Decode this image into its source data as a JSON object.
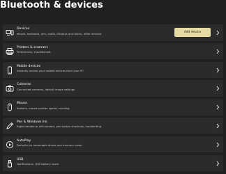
{
  "page": {
    "title": "Bluetooth & devices"
  },
  "items": [
    {
      "title": "Devices",
      "subtitle": "Mouse, keyboard, pen, audio, displays and docks, other devices",
      "action_label": "Add device",
      "icon": "devices-icon"
    },
    {
      "title": "Printers & scanners",
      "subtitle": "Preferences, troubleshoot",
      "icon": "printer-icon"
    },
    {
      "title": "Mobile devices",
      "subtitle": "Instantly access your mobile devices from your PC",
      "icon": "phone-icon"
    },
    {
      "title": "Cameras",
      "subtitle": "Connected cameras, default image settings",
      "icon": "camera-icon"
    },
    {
      "title": "Mouse",
      "subtitle": "Buttons, mouse pointer speed, scrolling",
      "icon": "mouse-icon"
    },
    {
      "title": "Pen & Windows Ink",
      "subtitle": "Right-handed or left-handed, pen button shortcuts, handwriting",
      "icon": "pen-icon"
    },
    {
      "title": "AutoPlay",
      "subtitle": "Defaults for removable drives and memory cards",
      "icon": "autoplay-icon"
    },
    {
      "title": "USB",
      "subtitle": "Notifications, USB battery saver",
      "icon": "usb-icon"
    }
  ],
  "colors": {
    "background": "#202020",
    "card": "#2b2b2b",
    "accent": "#e7dba4"
  }
}
